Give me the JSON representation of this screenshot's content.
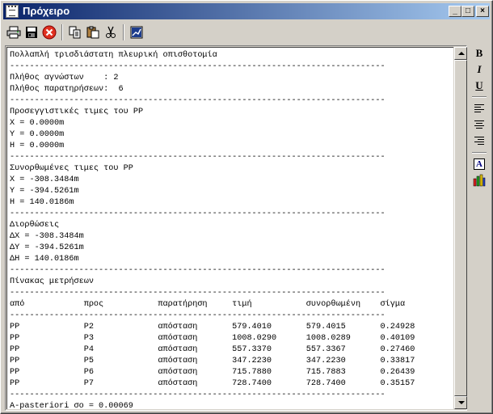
{
  "window": {
    "title": "Πρόχειρο",
    "buttons": {
      "minimize": "_",
      "maximize": "□",
      "close": "×"
    }
  },
  "toolbar": {
    "icons": [
      "printer-icon",
      "save-icon",
      "close-red-icon",
      "copy-icon",
      "paste-icon",
      "cut-icon",
      "chart-icon"
    ]
  },
  "sidebar": {
    "bold": "B",
    "italic": "I",
    "underline": "U",
    "font_color": "A"
  },
  "document": {
    "lines": [
      "Πολλαπλή τρισδιάστατη πλευρική οπισθοτομία",
      "----------------------------------------------------------------------------",
      "Πλήθος αγνώστων    : 2",
      "Πλήθος παρατηρήσεων:  6",
      "----------------------------------------------------------------------------",
      "Προσεγγιστικές τιμες του PP",
      "X = 0.0000m",
      "Y = 0.0000m",
      "H = 0.0000m",
      "----------------------------------------------------------------------------",
      "Συνορθωμένες τιμες του PP",
      "X = -308.3484m",
      "Y = -394.5261m",
      "H = 140.0186m",
      "----------------------------------------------------------------------------",
      "Διορθώσεις",
      "ΔX = -308.3484m",
      "ΔY = -394.5261m",
      "ΔH = 140.0186m",
      "----------------------------------------------------------------------------",
      "Πίνακας μετρήσεων",
      "----------------------------------------------------------------------------",
      "από            προς           παρατήρηση     τιμή           συνορθωμένη    σίγμα",
      "----------------------------------------------------------------------------",
      "PP             P2             απόσταση       579.4010       579.4015       0.24928",
      "PP             P3             απόσταση       1008.0290      1008.0289      0.40109",
      "PP             P4             απόσταση       557.3370       557.3367       0.27460",
      "PP             P5             απόσταση       347.2230       347.2230       0.33817",
      "PP             P6             απόσταση       715.7880       715.7883       0.26439",
      "PP             P7             απόσταση       728.7400       728.7400       0.35157",
      "----------------------------------------------------------------------------",
      "A-pasteriori σο = 0.00069"
    ]
  }
}
